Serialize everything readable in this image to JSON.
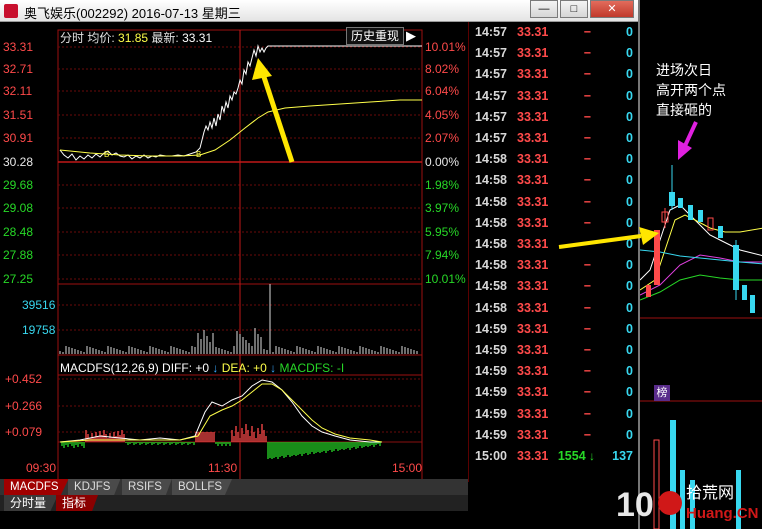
{
  "window": {
    "title": "奥飞娱乐(002292) 2016-07-13 星期三",
    "min_label": "—",
    "max_label": "□",
    "close_label": "✕"
  },
  "chart_header": {
    "label": "分时",
    "avg_label": "均价:",
    "avg": "31.85",
    "last_label": "最新:",
    "last": "33.31"
  },
  "replay_button": "历史重现",
  "price_axis": [
    {
      "price": "33.31",
      "pct": "10.01%",
      "color": "red"
    },
    {
      "price": "32.71",
      "pct": "8.02%",
      "color": "red"
    },
    {
      "price": "32.11",
      "pct": "6.04%",
      "color": "red"
    },
    {
      "price": "31.51",
      "pct": "4.05%",
      "color": "red"
    },
    {
      "price": "30.91",
      "pct": "2.07%",
      "color": "red"
    },
    {
      "price": "30.28",
      "pct": "0.00%",
      "color": "white"
    },
    {
      "price": "29.68",
      "pct": "1.98%",
      "color": "green"
    },
    {
      "price": "29.08",
      "pct": "3.97%",
      "color": "green"
    },
    {
      "price": "28.48",
      "pct": "5.95%",
      "color": "green"
    },
    {
      "price": "27.88",
      "pct": "7.94%",
      "color": "green"
    },
    {
      "price": "27.25",
      "pct": "10.01%",
      "color": "green"
    }
  ],
  "volume_axis": [
    "39516",
    "19758"
  ],
  "macd": {
    "header": {
      "name": "MACDFS(12,26,9)",
      "diff_label": "DIFF:",
      "diff": "+0",
      "dea_label": "DEA:",
      "dea": "+0",
      "macdfs_label": "MACDFS:",
      "macdfs": "-I"
    },
    "axis": [
      "+0.452",
      "+0.266",
      "+0.079"
    ]
  },
  "time_axis": [
    "09:30",
    "11:30",
    "15:00"
  ],
  "indicator_tabs": [
    "MACDFS",
    "KDJFS",
    "RSIFS",
    "BOLLFS"
  ],
  "bottom_tabs": [
    "分时量",
    "指标"
  ],
  "ticks": [
    {
      "time": "14:57",
      "price": "33.31",
      "vol": "−",
      "n": "0"
    },
    {
      "time": "14:57",
      "price": "33.31",
      "vol": "−",
      "n": "0"
    },
    {
      "time": "14:57",
      "price": "33.31",
      "vol": "−",
      "n": "0"
    },
    {
      "time": "14:57",
      "price": "33.31",
      "vol": "−",
      "n": "0"
    },
    {
      "time": "14:57",
      "price": "33.31",
      "vol": "−",
      "n": "0"
    },
    {
      "time": "14:57",
      "price": "33.31",
      "vol": "−",
      "n": "0"
    },
    {
      "time": "14:58",
      "price": "33.31",
      "vol": "−",
      "n": "0"
    },
    {
      "time": "14:58",
      "price": "33.31",
      "vol": "−",
      "n": "0"
    },
    {
      "time": "14:58",
      "price": "33.31",
      "vol": "−",
      "n": "0"
    },
    {
      "time": "14:58",
      "price": "33.31",
      "vol": "−",
      "n": "0"
    },
    {
      "time": "14:58",
      "price": "33.31",
      "vol": "−",
      "n": "0"
    },
    {
      "time": "14:58",
      "price": "33.31",
      "vol": "−",
      "n": "0"
    },
    {
      "time": "14:58",
      "price": "33.31",
      "vol": "−",
      "n": "0"
    },
    {
      "time": "14:58",
      "price": "33.31",
      "vol": "−",
      "n": "0"
    },
    {
      "time": "14:59",
      "price": "33.31",
      "vol": "−",
      "n": "0"
    },
    {
      "time": "14:59",
      "price": "33.31",
      "vol": "−",
      "n": "0"
    },
    {
      "time": "14:59",
      "price": "33.31",
      "vol": "−",
      "n": "0"
    },
    {
      "time": "14:59",
      "price": "33.31",
      "vol": "−",
      "n": "0"
    },
    {
      "time": "14:59",
      "price": "33.31",
      "vol": "−",
      "n": "0"
    },
    {
      "time": "14:59",
      "price": "33.31",
      "vol": "−",
      "n": "0"
    },
    {
      "time": "15:00",
      "price": "33.31",
      "vol": "1554",
      "dir": "↓",
      "n": "137"
    }
  ],
  "annotation": [
    "进场次日",
    "高开两个点",
    "直接砸的"
  ],
  "rank_badge": "榜",
  "watermark": {
    "num": "10",
    "brand": "拾荒网",
    "sub": "Huang.CN"
  },
  "colors": {
    "up": "#ff4a4a",
    "down": "#27d827",
    "avg_line": "#ffff4a",
    "frame": "#9b1010",
    "arrow": "#ffe600",
    "annotation_arrow": "#e020e0"
  }
}
